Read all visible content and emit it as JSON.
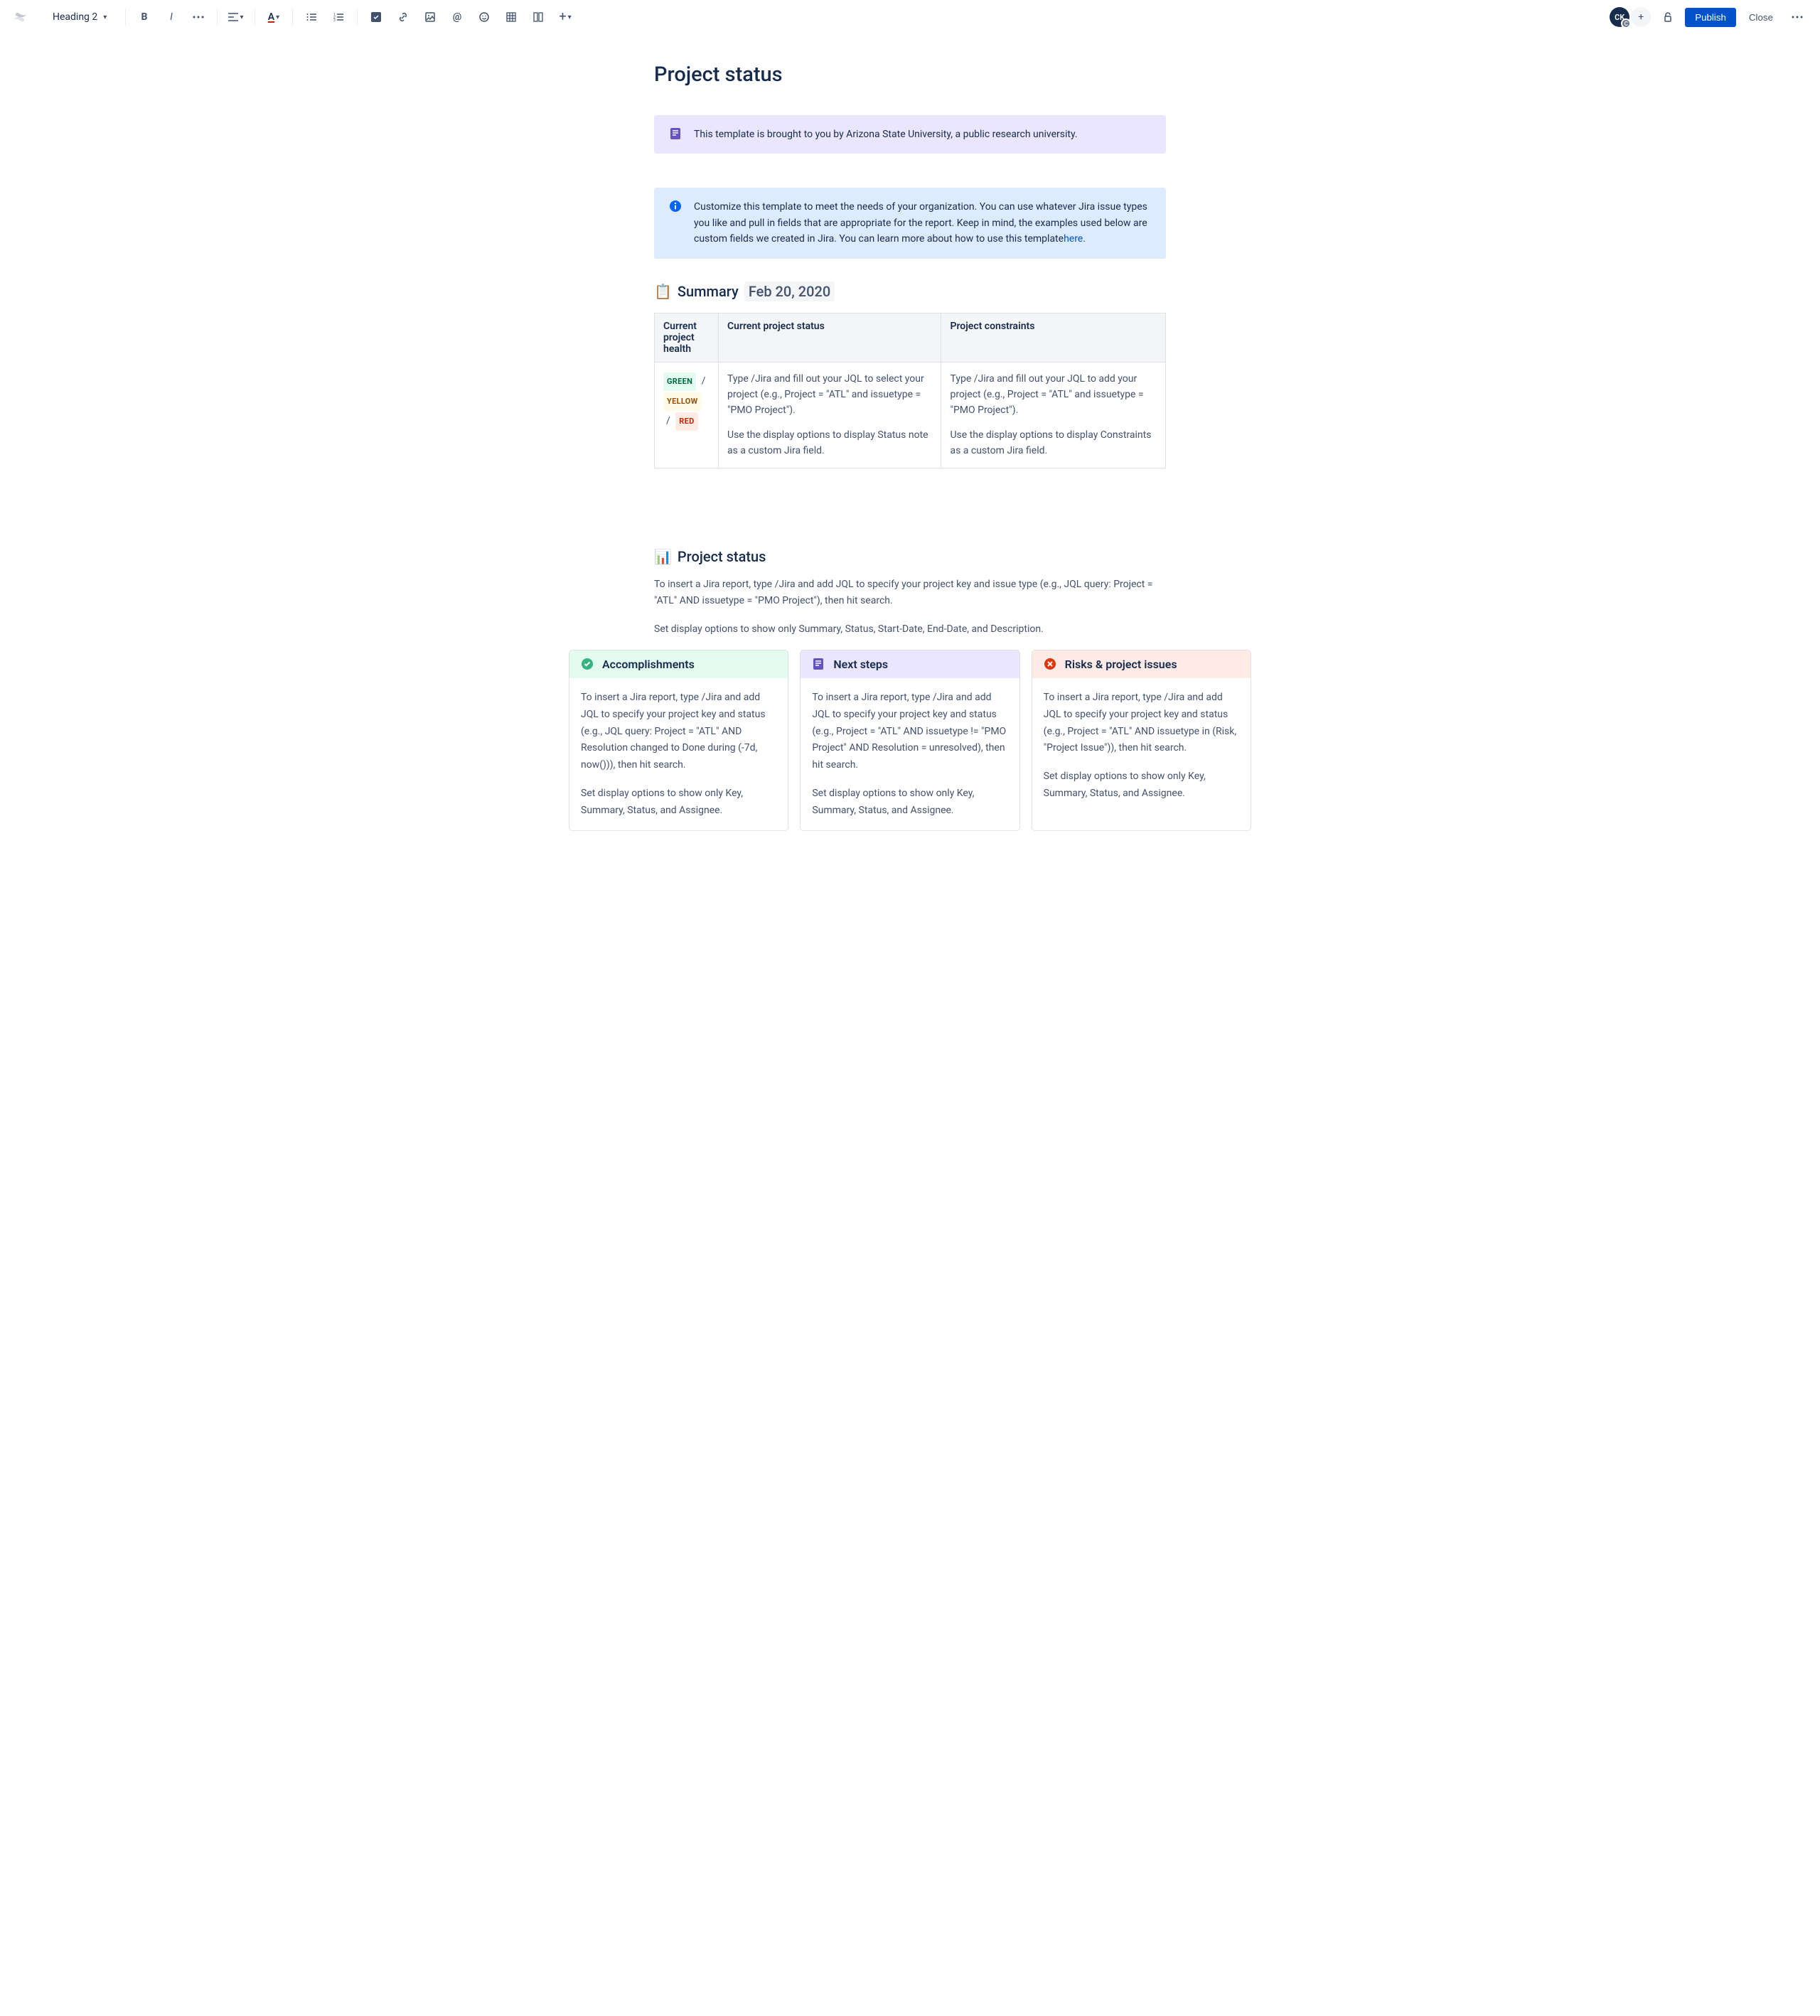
{
  "toolbar": {
    "heading_selector": "Heading 2",
    "avatar_initials": "CK",
    "avatar_badge": "C",
    "publish_label": "Publish",
    "close_label": "Close",
    "text_color_letter": "A"
  },
  "page": {
    "title": "Project status"
  },
  "panels": {
    "template_note": "This template is brought to you by Arizona State University, a public research university.",
    "info_text": "Customize this template to meet the needs of your organization. You can use whatever Jira issue types you like and pull in fields that are appropriate for the report. Keep in mind, the examples used below are custom fields we created in Jira. You can learn more about how to use this template",
    "info_link": "here",
    "info_period": "."
  },
  "summary": {
    "heading": "Summary",
    "date": "Feb 20, 2020",
    "emoji": "📋",
    "columns": [
      "Current project health",
      "Current project status",
      "Project constraints"
    ],
    "health": {
      "green": "GREEN",
      "yellow": "YELLOW",
      "red": "RED",
      "sep": "/"
    },
    "status_p1": "Type /Jira and fill out your JQL to select your project (e.g., Project = \"ATL\" and issuetype = \"PMO Project\").",
    "status_p2": "Use the display options to display Status note as a custom Jira field.",
    "constraints_p1": "Type /Jira and fill out your JQL to add your project (e.g., Project = \"ATL\" and issuetype = \"PMO Project\").",
    "constraints_p2": "Use the display options to display Constraints as a custom Jira field."
  },
  "project_status": {
    "emoji": "📊",
    "heading": "Project status",
    "p1": "To insert a Jira report, type /Jira and add JQL to specify your project key and issue type (e.g., JQL query: Project = \"ATL\" AND issuetype = \"PMO Project\"), then hit search.",
    "p2": "Set display options to show only Summary, Status, Start-Date, End-Date, and Description."
  },
  "cards": {
    "accomplishments": {
      "title": "Accomplishments",
      "p1": "To insert a Jira report, type /Jira and add JQL to specify your project key and status (e.g., JQL query: Project = \"ATL\" AND Resolution changed to Done during (-7d, now())), then hit search.",
      "p2": "Set display options to show only Key, Summary, Status, and Assignee."
    },
    "next_steps": {
      "title": "Next steps",
      "p1": "To insert a Jira report, type /Jira and add JQL to specify your project key and status (e.g., Project = \"ATL\" AND issuetype != \"PMO Project\" AND Resolution = unresolved), then hit search.",
      "p2": "Set display options to show only Key, Summary, Status, and Assignee."
    },
    "risks": {
      "title": "Risks & project issues",
      "p1": "To insert a Jira report, type /Jira and add JQL to specify your project key and status (e.g., Project = \"ATL\" AND issuetype in (Risk, \"Project Issue\")), then hit search.",
      "p2": "Set display options to show only Key, Summary, Status, and Assignee."
    }
  }
}
